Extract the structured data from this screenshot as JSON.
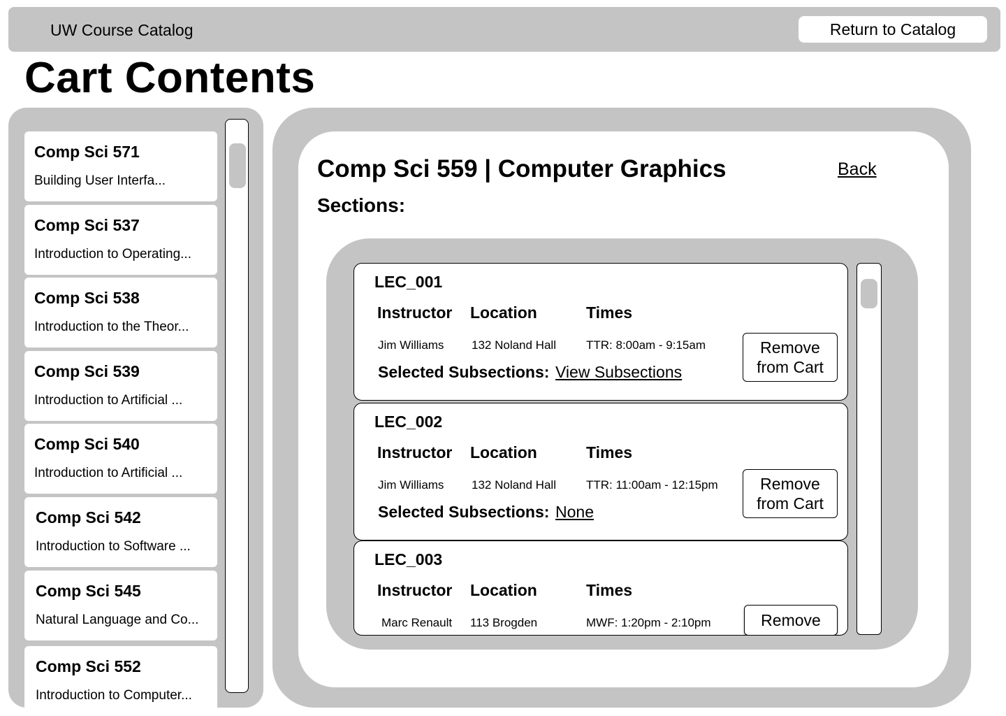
{
  "header": {
    "app_title": "UW Course Catalog",
    "return_button": "Return to Catalog"
  },
  "page_title": "Cart Contents",
  "cart_list": [
    {
      "code": "Comp Sci 571",
      "name": "Building User Interfa..."
    },
    {
      "code": "Comp Sci 537",
      "name": "Introduction to Operating..."
    },
    {
      "code": "Comp Sci 538",
      "name": "Introduction to the Theor..."
    },
    {
      "code": "Comp Sci 539",
      "name": "Introduction to Artificial ..."
    },
    {
      "code": "Comp Sci 540",
      "name": "Introduction to Artificial ..."
    },
    {
      "code": "Comp Sci 542",
      "name": "Introduction to Software ..."
    },
    {
      "code": "Comp Sci 545",
      "name": "Natural Language and Co..."
    },
    {
      "code": "Comp Sci 552",
      "name": "Introduction to Computer..."
    }
  ],
  "detail": {
    "course_title": "Comp Sci 559 | Computer Graphics",
    "back_label": "Back",
    "sections_label": "Sections:",
    "columns": {
      "instructor": "Instructor",
      "location": "Location",
      "times": "Times"
    },
    "subsections_label": "Selected Subsections:",
    "sections": [
      {
        "name": "LEC_001",
        "instructor": "Jim Williams",
        "location": "132 Noland Hall",
        "times": "TTR: 8:00am - 9:15am",
        "subsections": "View Subsections",
        "button": "Remove from Cart"
      },
      {
        "name": "LEC_002",
        "instructor": "Jim Williams",
        "location": "132 Noland Hall",
        "times": "TTR: 11:00am - 12:15pm",
        "subsections": "None",
        "button": "Remove from Cart"
      },
      {
        "name": "LEC_003",
        "instructor": "Marc Renault",
        "location": "113 Brogden",
        "times": "MWF: 1:20pm - 2:10pm",
        "button": "Remove"
      }
    ]
  }
}
